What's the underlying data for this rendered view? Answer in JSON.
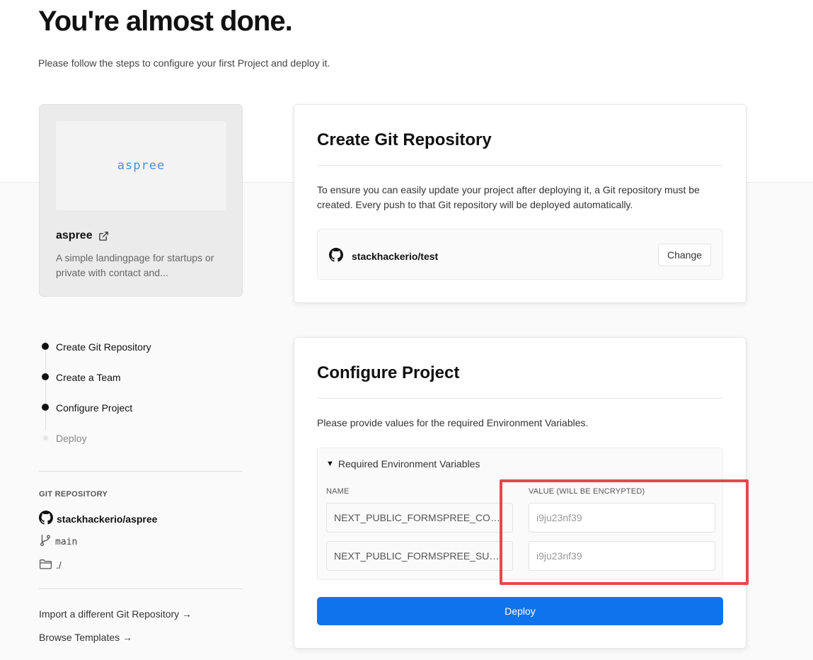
{
  "header": {
    "title": "You're almost done.",
    "subtitle": "Please follow the steps to configure your first Project and deploy it."
  },
  "template": {
    "preview_text": "aspree",
    "name": "aspree",
    "description": "A simple landingpage for startups or private with contact and..."
  },
  "steps": [
    {
      "label": "Create Git Repository",
      "state": "done"
    },
    {
      "label": "Create a Team",
      "state": "done"
    },
    {
      "label": "Configure Project",
      "state": "done"
    },
    {
      "label": "Deploy",
      "state": "pending"
    }
  ],
  "git": {
    "section_title": "GIT REPOSITORY",
    "repo": "stackhackerio/aspree",
    "branch": "main",
    "directory": "./"
  },
  "links": {
    "import": "Import a different Git Repository →",
    "browse": "Browse Templates →"
  },
  "create_repo": {
    "title": "Create Git Repository",
    "description": "To ensure you can easily update your project after deploying it, a Git repository must be created. Every push to that Git repository will be deployed automatically.",
    "repo": "stackhackerio/test",
    "change_label": "Change"
  },
  "configure": {
    "title": "Configure Project",
    "description": "Please provide values for the required Environment Variables.",
    "env_summary": "Required Environment Variables",
    "name_header": "NAME",
    "value_header": "VALUE (WILL BE ENCRYPTED)",
    "variables": [
      {
        "name": "NEXT_PUBLIC_FORMSPREE_CONT...",
        "value_placeholder": "i9ju23nf39"
      },
      {
        "name": "NEXT_PUBLIC_FORMSPREE_SUBS...",
        "value_placeholder": "i9ju23nf39"
      }
    ],
    "deploy_label": "Deploy"
  },
  "colors": {
    "accent": "#0f74ec",
    "highlight": "#e5484d",
    "template_brand": "#4a90e2"
  }
}
